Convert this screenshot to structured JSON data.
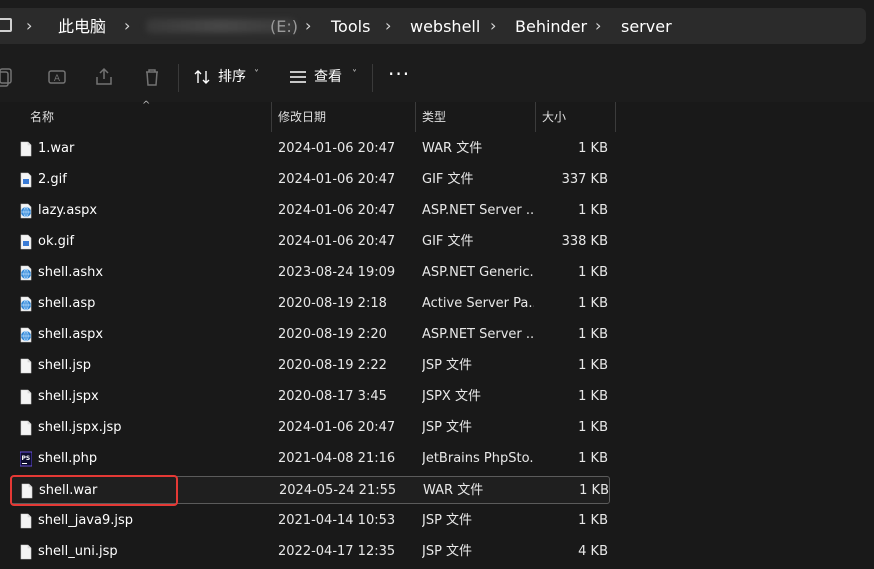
{
  "breadcrumb": {
    "items": [
      "此电脑",
      "(E:)",
      "Tools",
      "webshell",
      "Behinder",
      "server"
    ]
  },
  "toolbar": {
    "sort_label": "排序",
    "view_label": "查看",
    "more_label": "···"
  },
  "columns": {
    "name": "名称",
    "date": "修改日期",
    "type": "类型",
    "size": "大小"
  },
  "files": [
    {
      "name": "1.war",
      "date": "2024-01-06 20:47",
      "type": "WAR 文件",
      "size": "1 KB",
      "icon": "file-icon"
    },
    {
      "name": "2.gif",
      "date": "2024-01-06 20:47",
      "type": "GIF 文件",
      "size": "337 KB",
      "icon": "image-file-icon"
    },
    {
      "name": "lazy.aspx",
      "date": "2024-01-06 20:47",
      "type": "ASP.NET Server ...",
      "size": "1 KB",
      "icon": "web-file-icon"
    },
    {
      "name": "ok.gif",
      "date": "2024-01-06 20:47",
      "type": "GIF 文件",
      "size": "338 KB",
      "icon": "image-file-icon"
    },
    {
      "name": "shell.ashx",
      "date": "2023-08-24 19:09",
      "type": "ASP.NET Generic...",
      "size": "1 KB",
      "icon": "web-file-icon"
    },
    {
      "name": "shell.asp",
      "date": "2020-08-19 2:18",
      "type": "Active Server Pa...",
      "size": "1 KB",
      "icon": "web-file-icon"
    },
    {
      "name": "shell.aspx",
      "date": "2020-08-19 2:20",
      "type": "ASP.NET Server ...",
      "size": "1 KB",
      "icon": "web-file-icon"
    },
    {
      "name": "shell.jsp",
      "date": "2020-08-19 2:22",
      "type": "JSP 文件",
      "size": "1 KB",
      "icon": "file-icon"
    },
    {
      "name": "shell.jspx",
      "date": "2020-08-17 3:45",
      "type": "JSPX 文件",
      "size": "1 KB",
      "icon": "file-icon"
    },
    {
      "name": "shell.jspx.jsp",
      "date": "2024-01-06 20:47",
      "type": "JSP 文件",
      "size": "1 KB",
      "icon": "file-icon"
    },
    {
      "name": "shell.php",
      "date": "2021-04-08 21:16",
      "type": "JetBrains PhpSto...",
      "size": "1 KB",
      "icon": "phpstorm-file-icon"
    },
    {
      "name": "shell.war",
      "date": "2024-05-24 21:55",
      "type": "WAR 文件",
      "size": "1 KB",
      "icon": "file-icon",
      "selected": true
    },
    {
      "name": "shell_java9.jsp",
      "date": "2021-04-14 10:53",
      "type": "JSP 文件",
      "size": "1 KB",
      "icon": "file-icon"
    },
    {
      "name": "shell_uni.jsp",
      "date": "2022-04-17 12:35",
      "type": "JSP 文件",
      "size": "4 KB",
      "icon": "file-icon"
    }
  ],
  "colors": {
    "highlight": "#e53935",
    "background": "#191919"
  }
}
